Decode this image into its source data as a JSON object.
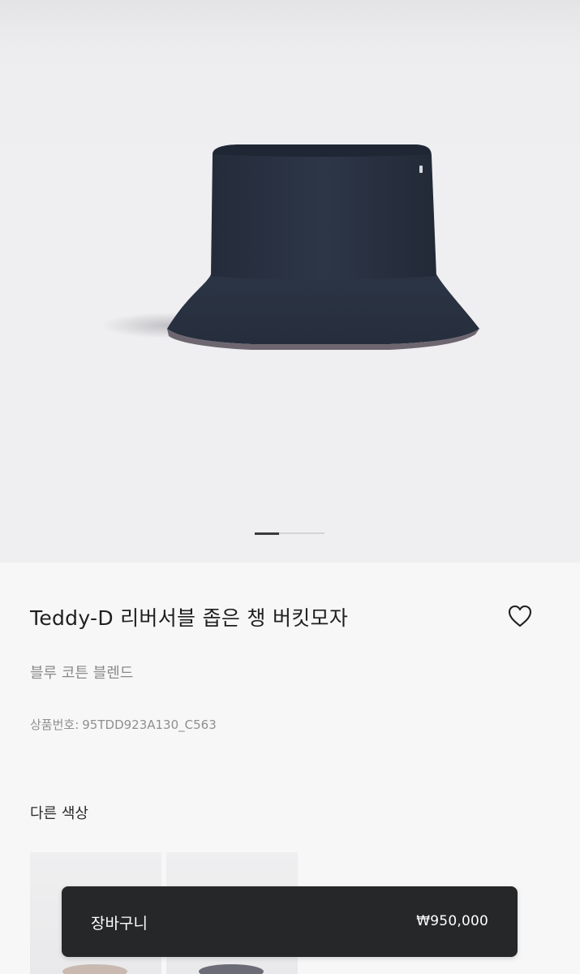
{
  "product": {
    "image_alt": "",
    "carousel": {
      "total": 3,
      "current": 1
    },
    "title": "Teddy-D 리버서블 좁은 챙 버킷모자",
    "subtitle": "블루 코튼 블렌드",
    "sku_label": "상품번호:",
    "sku_value": "95TDD923A130_C563",
    "wishlist_icon": "heart-outline-icon",
    "hat_color": "#2a3344"
  },
  "other_colors": {
    "title": "다른 색상",
    "swatches": [
      {
        "color": "#c9b9b0"
      },
      {
        "color": "#6b6c75"
      }
    ]
  },
  "cart": {
    "label": "장바구니",
    "price": "₩950,000"
  },
  "colors": {
    "cart_bg": "#262728",
    "page_bg": "#f7f7f7",
    "hero_bg": "#efeff1"
  }
}
